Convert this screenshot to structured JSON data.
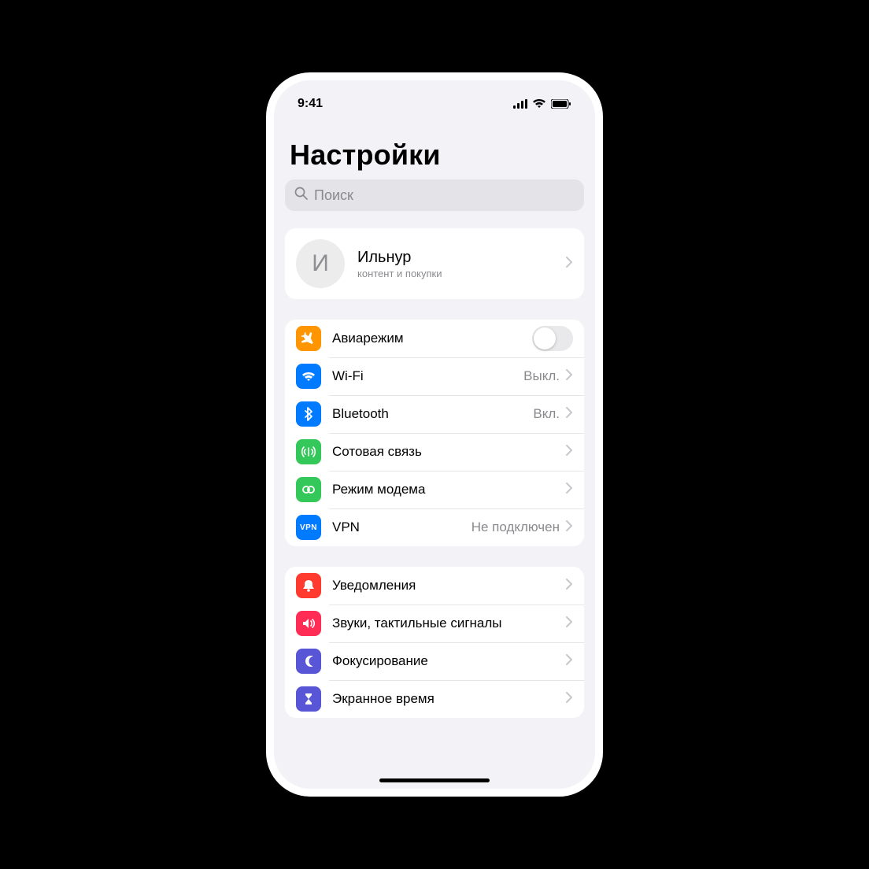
{
  "status": {
    "time": "9:41"
  },
  "header": {
    "title": "Настройки"
  },
  "search": {
    "placeholder": "Поиск"
  },
  "profile": {
    "initial": "И",
    "name": "Ильнур",
    "subtitle": "контент и покупки"
  },
  "colors": {
    "orange": "#ff9500",
    "blue": "#007aff",
    "green": "#34c759",
    "red": "#ff3b30",
    "pink": "#ff2d55",
    "indigo": "#5856d6",
    "gray": "#8e8e93"
  },
  "groups": [
    {
      "id": "connectivity",
      "rows": [
        {
          "id": "airplane",
          "icon": "airplane-icon",
          "color": "orange",
          "label": "Авиарежим",
          "control": "toggle",
          "toggle": false
        },
        {
          "id": "wifi",
          "icon": "wifi-icon",
          "color": "blue",
          "label": "Wi-Fi",
          "value": "Выкл.",
          "control": "disclosure"
        },
        {
          "id": "bluetooth",
          "icon": "bluetooth-icon",
          "color": "blue",
          "label": "Bluetooth",
          "value": "Вкл.",
          "control": "disclosure"
        },
        {
          "id": "cellular",
          "icon": "cellular-icon",
          "color": "green",
          "label": "Сотовая связь",
          "control": "disclosure"
        },
        {
          "id": "hotspot",
          "icon": "hotspot-icon",
          "color": "green",
          "label": "Режим модема",
          "control": "disclosure"
        },
        {
          "id": "vpn",
          "icon": "vpn-icon",
          "color": "blue",
          "label": "VPN",
          "value": "Не подключен",
          "control": "disclosure"
        }
      ]
    },
    {
      "id": "system",
      "rows": [
        {
          "id": "notifications",
          "icon": "bell-icon",
          "color": "red",
          "label": "Уведомления",
          "control": "disclosure"
        },
        {
          "id": "sounds",
          "icon": "speaker-icon",
          "color": "pink",
          "label": "Звуки, тактильные сигналы",
          "control": "disclosure"
        },
        {
          "id": "focus",
          "icon": "moon-icon",
          "color": "indigo",
          "label": "Фокусирование",
          "control": "disclosure"
        },
        {
          "id": "screentime",
          "icon": "hourglass-icon",
          "color": "indigo",
          "label": "Экранное время",
          "control": "disclosure"
        }
      ]
    }
  ]
}
